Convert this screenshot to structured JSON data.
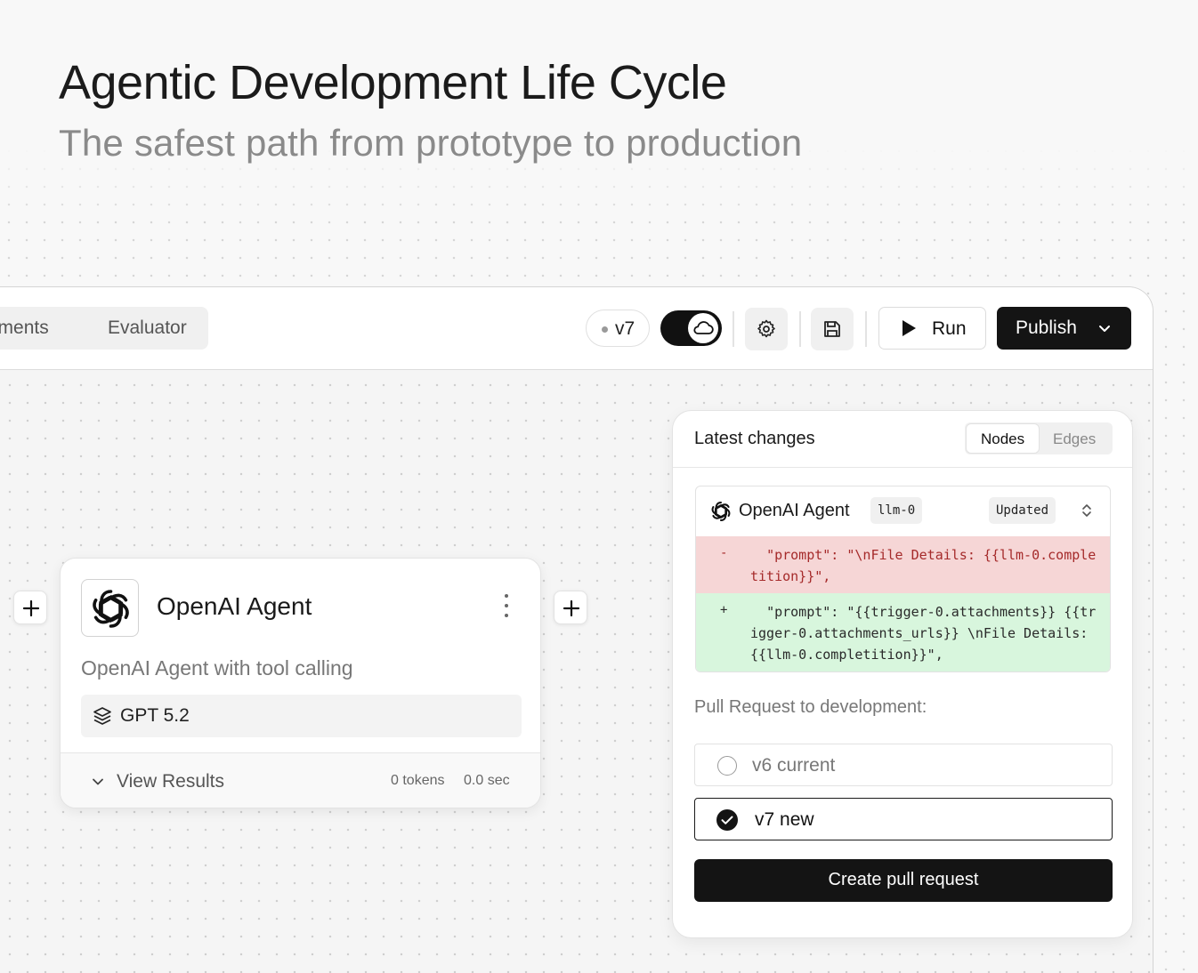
{
  "hero": {
    "title": "Agentic Development Life Cycle",
    "subtitle": "The safest path from prototype to production"
  },
  "toolbar": {
    "tabs": [
      "ployments",
      "Evaluator"
    ],
    "version": "v7",
    "run_label": "Run",
    "publish_label": "Publish"
  },
  "agent_card": {
    "title": "OpenAI Agent",
    "description": "OpenAI Agent with tool calling",
    "model": "GPT 5.2",
    "view_results": "View Results",
    "tokens": "0 tokens",
    "duration": "0.0 sec"
  },
  "changes_panel": {
    "title": "Latest changes",
    "segments": [
      "Nodes",
      "Edges"
    ],
    "active_segment": "Nodes",
    "diff": {
      "node_name": "OpenAI Agent",
      "node_id": "llm-0",
      "status": "Updated",
      "removed_sign": "-",
      "removed_text": "  \"prompt\": \"\\nFile Details: {{llm-0.completition}}\",",
      "added_sign": "+",
      "added_text": "  \"prompt\": \"{{trigger-0.attachments}} {{trigger-0.attachments_urls}} \\nFile Details: {{llm-0.completition}}\","
    },
    "pr_label": "Pull Request to development:",
    "options": [
      {
        "label": "v6  current",
        "selected": false
      },
      {
        "label": "v7  new",
        "selected": true
      }
    ],
    "create_button": "Create pull request"
  },
  "colors": {
    "accent_dark": "#141414",
    "diff_removed_bg": "#f6d6d6",
    "diff_added_bg": "#d8f6dd",
    "diff_removed_text": "#a52a2a"
  },
  "icons": {
    "toolbar": [
      "cloud-icon",
      "gear-icon",
      "save-icon",
      "play-icon",
      "chevron-down-icon"
    ],
    "agent": [
      "openai-logo-icon",
      "kebab-menu-icon",
      "layers-icon",
      "chevron-down-icon",
      "plus-icon"
    ],
    "panel": [
      "openai-logo-icon",
      "sort-icon",
      "radio-check-icon"
    ]
  }
}
